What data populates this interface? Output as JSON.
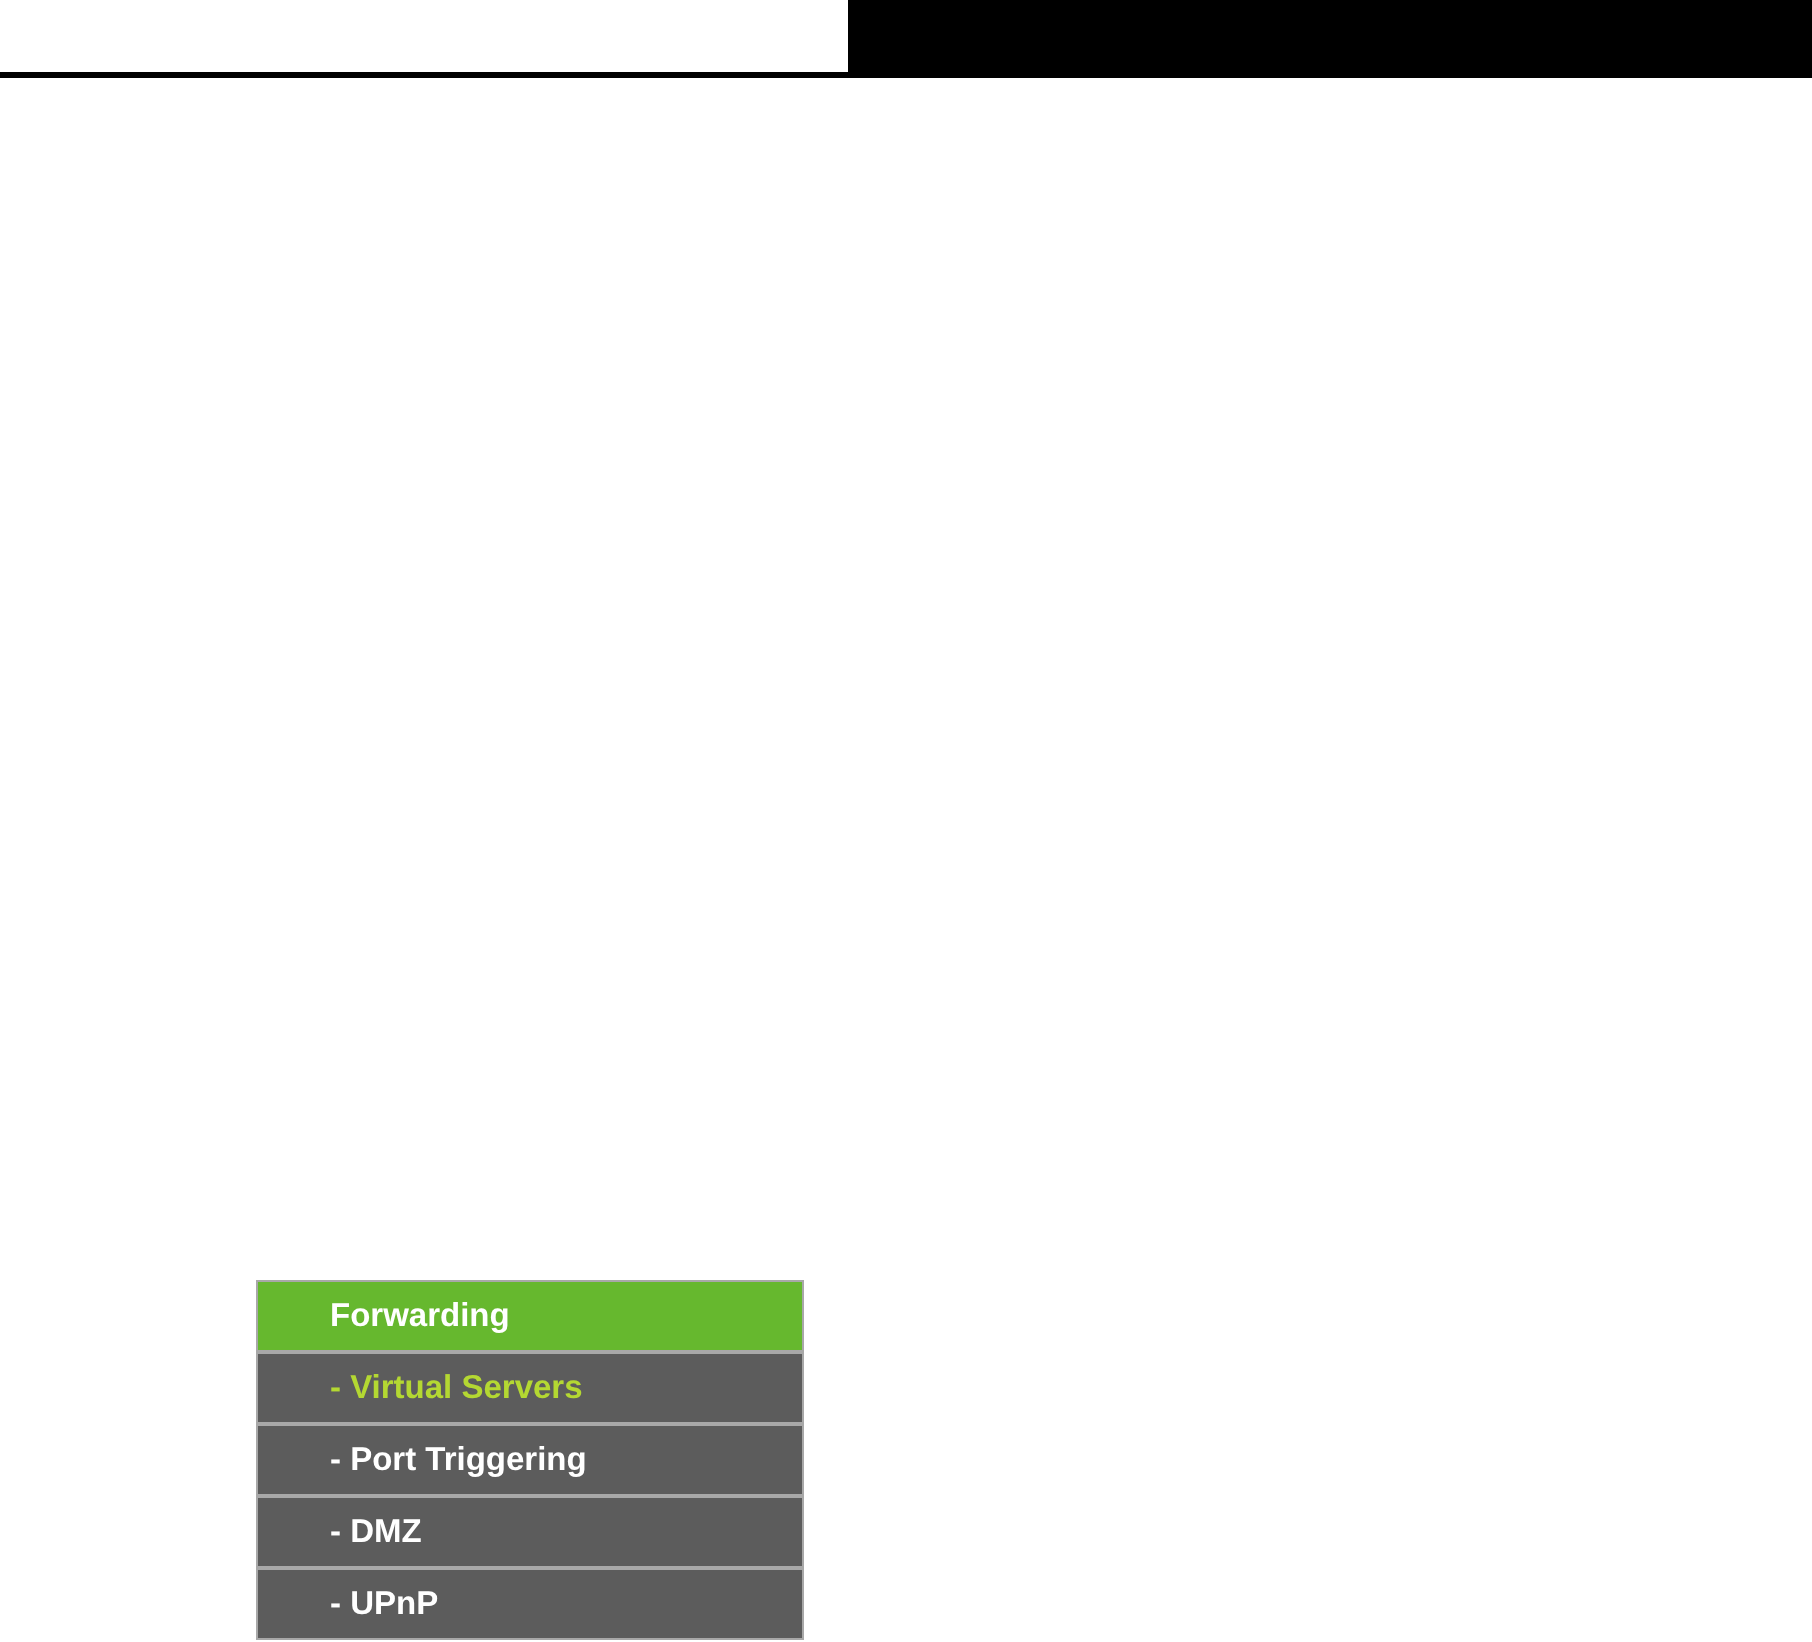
{
  "menu": {
    "title": "Forwarding",
    "items": [
      {
        "label": "- Virtual Servers",
        "selected": true
      },
      {
        "label": "- Port Triggering",
        "selected": false
      },
      {
        "label": "- DMZ",
        "selected": false
      },
      {
        "label": "- UPnP",
        "selected": false
      }
    ]
  }
}
